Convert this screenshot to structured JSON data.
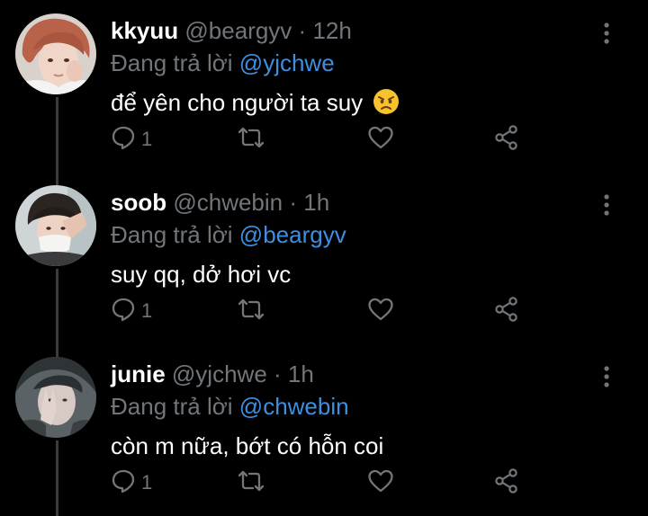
{
  "colors": {
    "background": "#000000",
    "name": "#ffffff",
    "secondary": "#71767b",
    "mention": "#3e8fdf",
    "thread_line": "#3a3d40"
  },
  "tweets": [
    {
      "name": "kkyuu",
      "handle": "@beargyv",
      "separator": "·",
      "time": "12h",
      "reply_prefix": "Đang trả lời",
      "reply_to": "@yjchwe",
      "text": "để yên cho người ta suy",
      "emoji": "angry-face-emoji",
      "reply_count": "1",
      "icons": [
        "reply-icon",
        "retweet-icon",
        "like-icon",
        "share-icon",
        "more-options-icon"
      ]
    },
    {
      "name": "soob",
      "handle": "@chwebin",
      "separator": "·",
      "time": "1h",
      "reply_prefix": "Đang trả lời",
      "reply_to": "@beargyv",
      "text": "suy qq, dở hơi vc",
      "reply_count": "1",
      "icons": [
        "reply-icon",
        "retweet-icon",
        "like-icon",
        "share-icon",
        "more-options-icon"
      ]
    },
    {
      "name": "junie",
      "handle": "@yjchwe",
      "separator": "·",
      "time": "1h",
      "reply_prefix": "Đang trả lời",
      "reply_to": "@chwebin",
      "text": "còn m nữa, bớt có hỗn coi",
      "reply_count": "1",
      "icons": [
        "reply-icon",
        "retweet-icon",
        "like-icon",
        "share-icon",
        "more-options-icon"
      ]
    }
  ]
}
